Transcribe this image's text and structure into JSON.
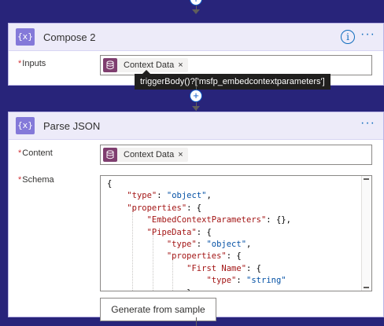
{
  "compose": {
    "title": "Compose 2",
    "inputs_label": "Inputs",
    "required_mark": "*",
    "token": {
      "label": "Context Data",
      "remove": "×"
    },
    "tooltip": "triggerBody()?['msfp_embedcontextparameters']",
    "info_glyph": "i",
    "more_glyph": "···"
  },
  "parse_json": {
    "title": "Parse JSON",
    "more_glyph": "···",
    "content_label": "Content",
    "schema_label": "Schema",
    "required_mark": "*",
    "token": {
      "label": "Context Data",
      "remove": "×"
    },
    "schema_lines": [
      "{",
      "    \"type\": \"object\",",
      "    \"properties\": {",
      "        \"EmbedContextParameters\": {},",
      "        \"PipeData\": {",
      "            \"type\": \"object\",",
      "            \"properties\": {",
      "                \"First Name\": {",
      "                    \"type\": \"string\"",
      "                },"
    ],
    "generate_button": "Generate from sample"
  },
  "connector_glyph": "+",
  "action_icon_glyph": "{x}",
  "colors": {
    "background": "#28247a",
    "card_header": "#edebf9",
    "action_icon": "#8479d9",
    "token_icon": "#7f3e6f",
    "link_blue": "#0f6cbd"
  }
}
